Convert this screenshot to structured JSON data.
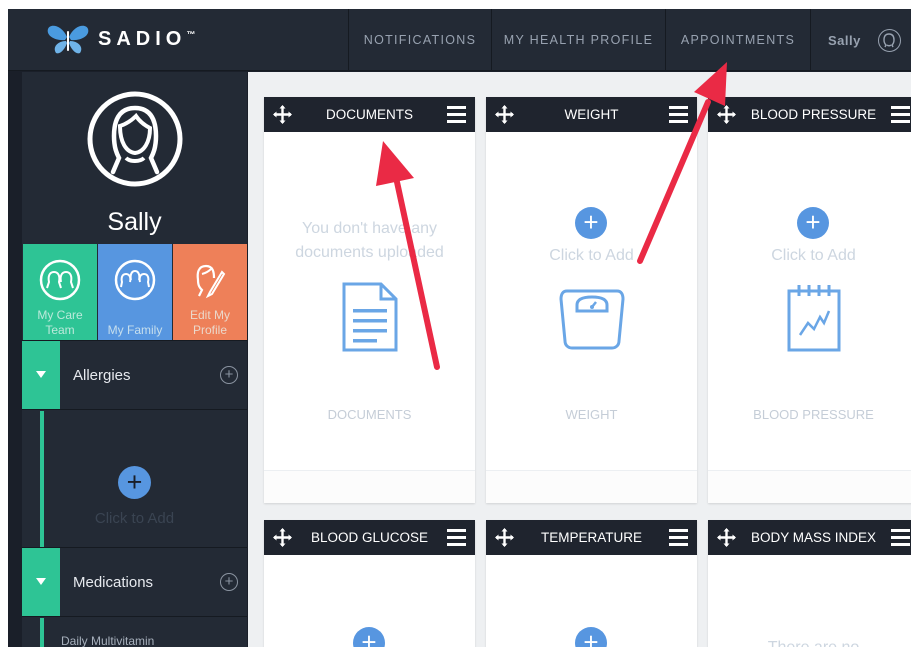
{
  "brand": {
    "name": "SADIO",
    "tm": "™"
  },
  "nav": {
    "notifications": "NOTIFICATIONS",
    "health_profile": "MY HEALTH PROFILE",
    "appointments": "APPOINTMENTS",
    "user": "Sally"
  },
  "sidebar": {
    "name": "Sally",
    "tiles": [
      {
        "label": "My Care Team",
        "color": "#2ec495"
      },
      {
        "label": "My Family",
        "color": "#5796e0"
      },
      {
        "label": "Edit My Profile",
        "color": "#ee8059"
      }
    ],
    "allergies": {
      "label": "Allergies",
      "add_label": "Click to Add"
    },
    "medications": {
      "label": "Medications",
      "items": [
        "Daily Multivitamin"
      ]
    }
  },
  "cards": {
    "documents": {
      "title": "DOCUMENTS",
      "empty": "You don't have any documents uploaded",
      "footer": "DOCUMENTS"
    },
    "weight": {
      "title": "WEIGHT",
      "add": "Click to Add",
      "footer": "WEIGHT"
    },
    "bp": {
      "title": "BLOOD PRESSURE",
      "add": "Click to Add",
      "footer": "BLOOD PRESSURE"
    },
    "glucose": {
      "title": "BLOOD GLUCOSE"
    },
    "temp": {
      "title": "TEMPERATURE"
    },
    "bmi": {
      "title": "BODY MASS INDEX",
      "empty": "There are no"
    }
  },
  "colors": {
    "accent_green": "#2ec495",
    "accent_blue": "#5796e0",
    "accent_orange": "#ee8059",
    "arrow_red": "#ea2a45"
  }
}
